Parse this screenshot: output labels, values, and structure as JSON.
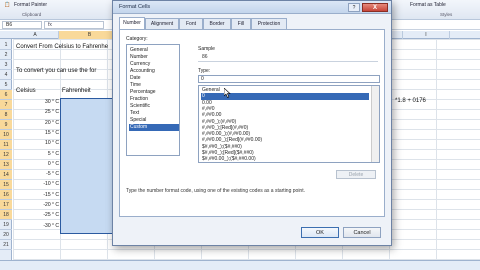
{
  "ribbon": {
    "format_painter": "Format Painter",
    "clipboard": "Clipboard",
    "format_as_table": "Format as Table",
    "cell_styles": "Styles",
    "styles_group": "Styles",
    "cells_group": "Cells"
  },
  "formula_bar": {
    "name_box": "B6",
    "fx": "fx"
  },
  "columns": [
    "A",
    "B",
    "C",
    "D",
    "E",
    "F",
    "G",
    "H",
    "I"
  ],
  "rows": [
    "1",
    "2",
    "3",
    "4",
    "5",
    "6",
    "7",
    "8",
    "9",
    "10",
    "11",
    "12",
    "13",
    "14",
    "15",
    "16",
    "17",
    "18",
    "19",
    "20",
    "21"
  ],
  "sheet": {
    "title": "Convert From Celsius to Fahrenhe",
    "instruction": "To convert you can use the for",
    "header_celsius": "Celsius",
    "header_fahrenheit": "Fahrenheit",
    "formula_note": "*1.8 + 0176",
    "celsius": [
      "30 ° C",
      "25 ° C",
      "20 ° C",
      "15 ° C",
      "10 ° C",
      "5 ° C",
      "0 ° C",
      "-5 ° C",
      "-10 ° C",
      "-15 ° C",
      "-20 ° C",
      "-25 ° C",
      "-30 ° C"
    ],
    "fahrenheit": [
      "86",
      "77",
      "68",
      "59",
      "50",
      "41",
      "32",
      "23",
      "14",
      "5",
      "-4",
      "-13",
      "-22"
    ]
  },
  "dialog": {
    "title": "Format Cells",
    "help": "?",
    "close": "X",
    "tabs": [
      "Number",
      "Alignment",
      "Font",
      "Border",
      "Fill",
      "Protection"
    ],
    "category_label": "Category:",
    "categories": [
      "General",
      "Number",
      "Currency",
      "Accounting",
      "Date",
      "Time",
      "Percentage",
      "Fraction",
      "Scientific",
      "Text",
      "Special",
      "Custom"
    ],
    "selected_category": "Custom",
    "sample_label": "Sample",
    "sample_value": "86",
    "type_label": "Type:",
    "type_value": "0",
    "formats": [
      "General",
      "0",
      "0.00",
      "#,##0",
      "#,##0.00",
      "#,##0_);(#,##0)",
      "#,##0_);[Red](#,##0)",
      "#,##0.00_);(#,##0.00)",
      "#,##0.00_);[Red](#,##0.00)",
      "$#,##0_);($#,##0)",
      "$#,##0_);[Red]($#,##0)",
      "$#,##0.00_);($#,##0.00)"
    ],
    "selected_format": "0",
    "delete_label": "Delete",
    "help_text": "Type the number format code, using one of the existing codes as a starting point.",
    "ok_label": "OK",
    "cancel_label": "Cancel"
  }
}
